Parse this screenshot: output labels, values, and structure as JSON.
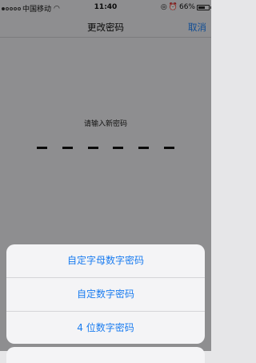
{
  "status_bar": {
    "carrier": "中国移动",
    "time": "11:40",
    "battery_text": "66%",
    "battery_level": 0.66
  },
  "nav": {
    "title": "更改密码",
    "cancel": "取消"
  },
  "content": {
    "prompt": "请输入新密码",
    "passcode_slots": 6
  },
  "action_sheet": {
    "options": [
      "自定字母数字密码",
      "自定数字密码",
      "4 位数字密码"
    ]
  },
  "colors": {
    "accent": "#1a7cf0"
  }
}
